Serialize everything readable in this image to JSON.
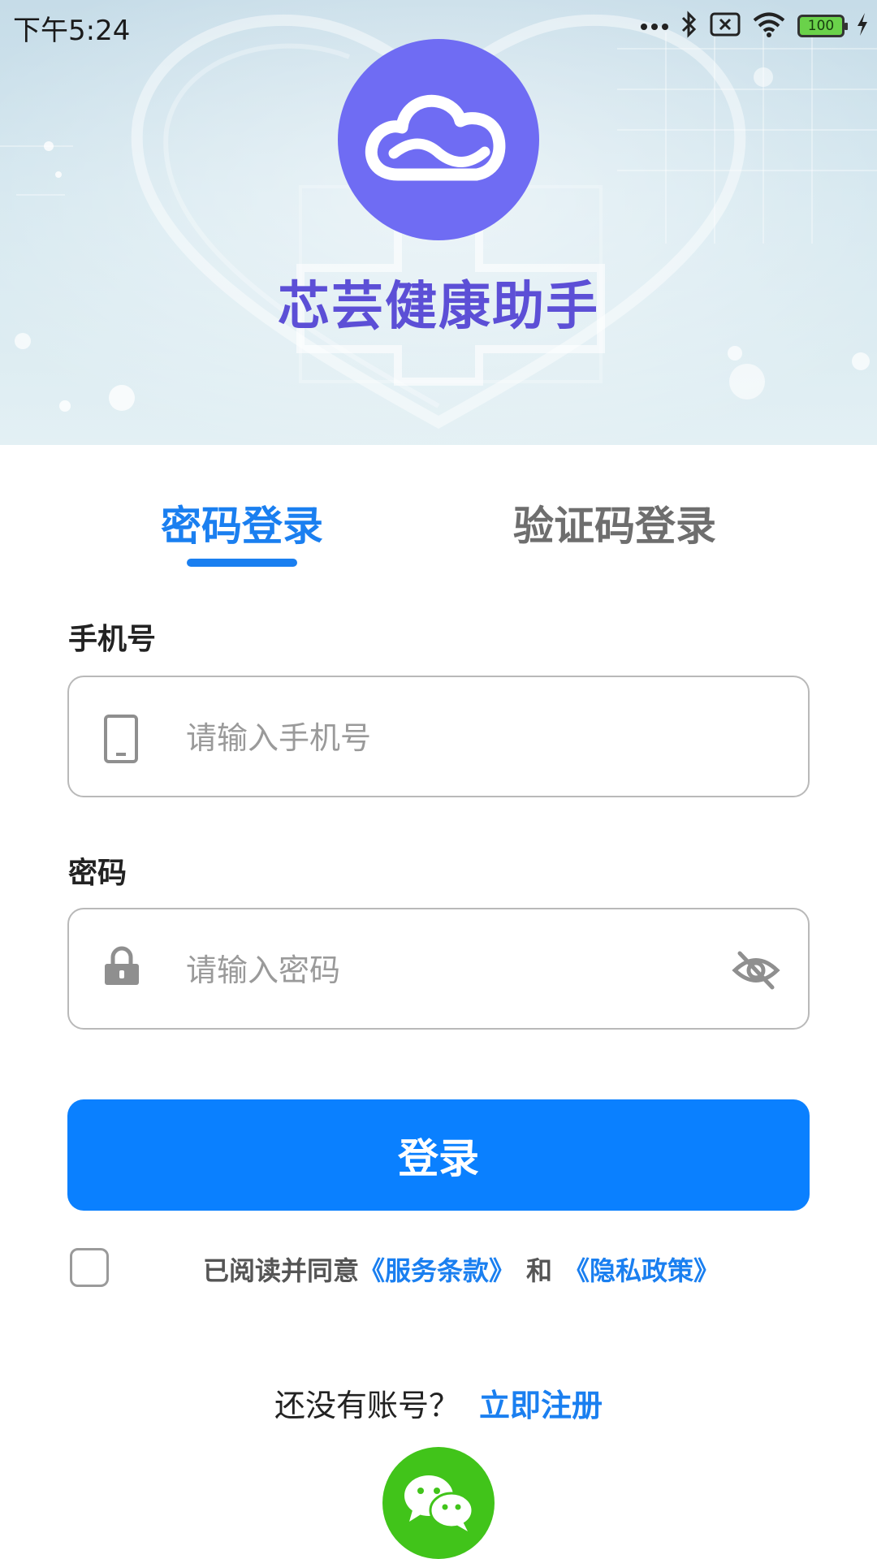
{
  "status_bar": {
    "time": "下午5:24",
    "battery": "100"
  },
  "app": {
    "title": "芯芸健康助手"
  },
  "tabs": [
    {
      "label": "密码登录",
      "active": true
    },
    {
      "label": "验证码登录",
      "active": false
    }
  ],
  "phone_field": {
    "label": "手机号",
    "placeholder": "请输入手机号",
    "value": ""
  },
  "password_field": {
    "label": "密码",
    "placeholder": "请输入密码",
    "value": ""
  },
  "login_button": {
    "label": "登录"
  },
  "agreement": {
    "checked": false,
    "prefix": "已阅读并同意",
    "terms_link": "《服务条款》",
    "conjunction": "和",
    "privacy_link": "《隐私政策》"
  },
  "register": {
    "prompt": "还没有账号？",
    "link": "立即注册"
  },
  "colors": {
    "accent": "#0a80ff",
    "logo": "#6f6cf3",
    "title": "#5c4fd6",
    "wechat": "#41c41a"
  },
  "icons": [
    "cloud-logo-icon",
    "phone-icon",
    "lock-icon",
    "eye-off-icon",
    "wechat-icon",
    "bluetooth-icon",
    "wifi-icon",
    "battery-icon",
    "charging-icon"
  ]
}
